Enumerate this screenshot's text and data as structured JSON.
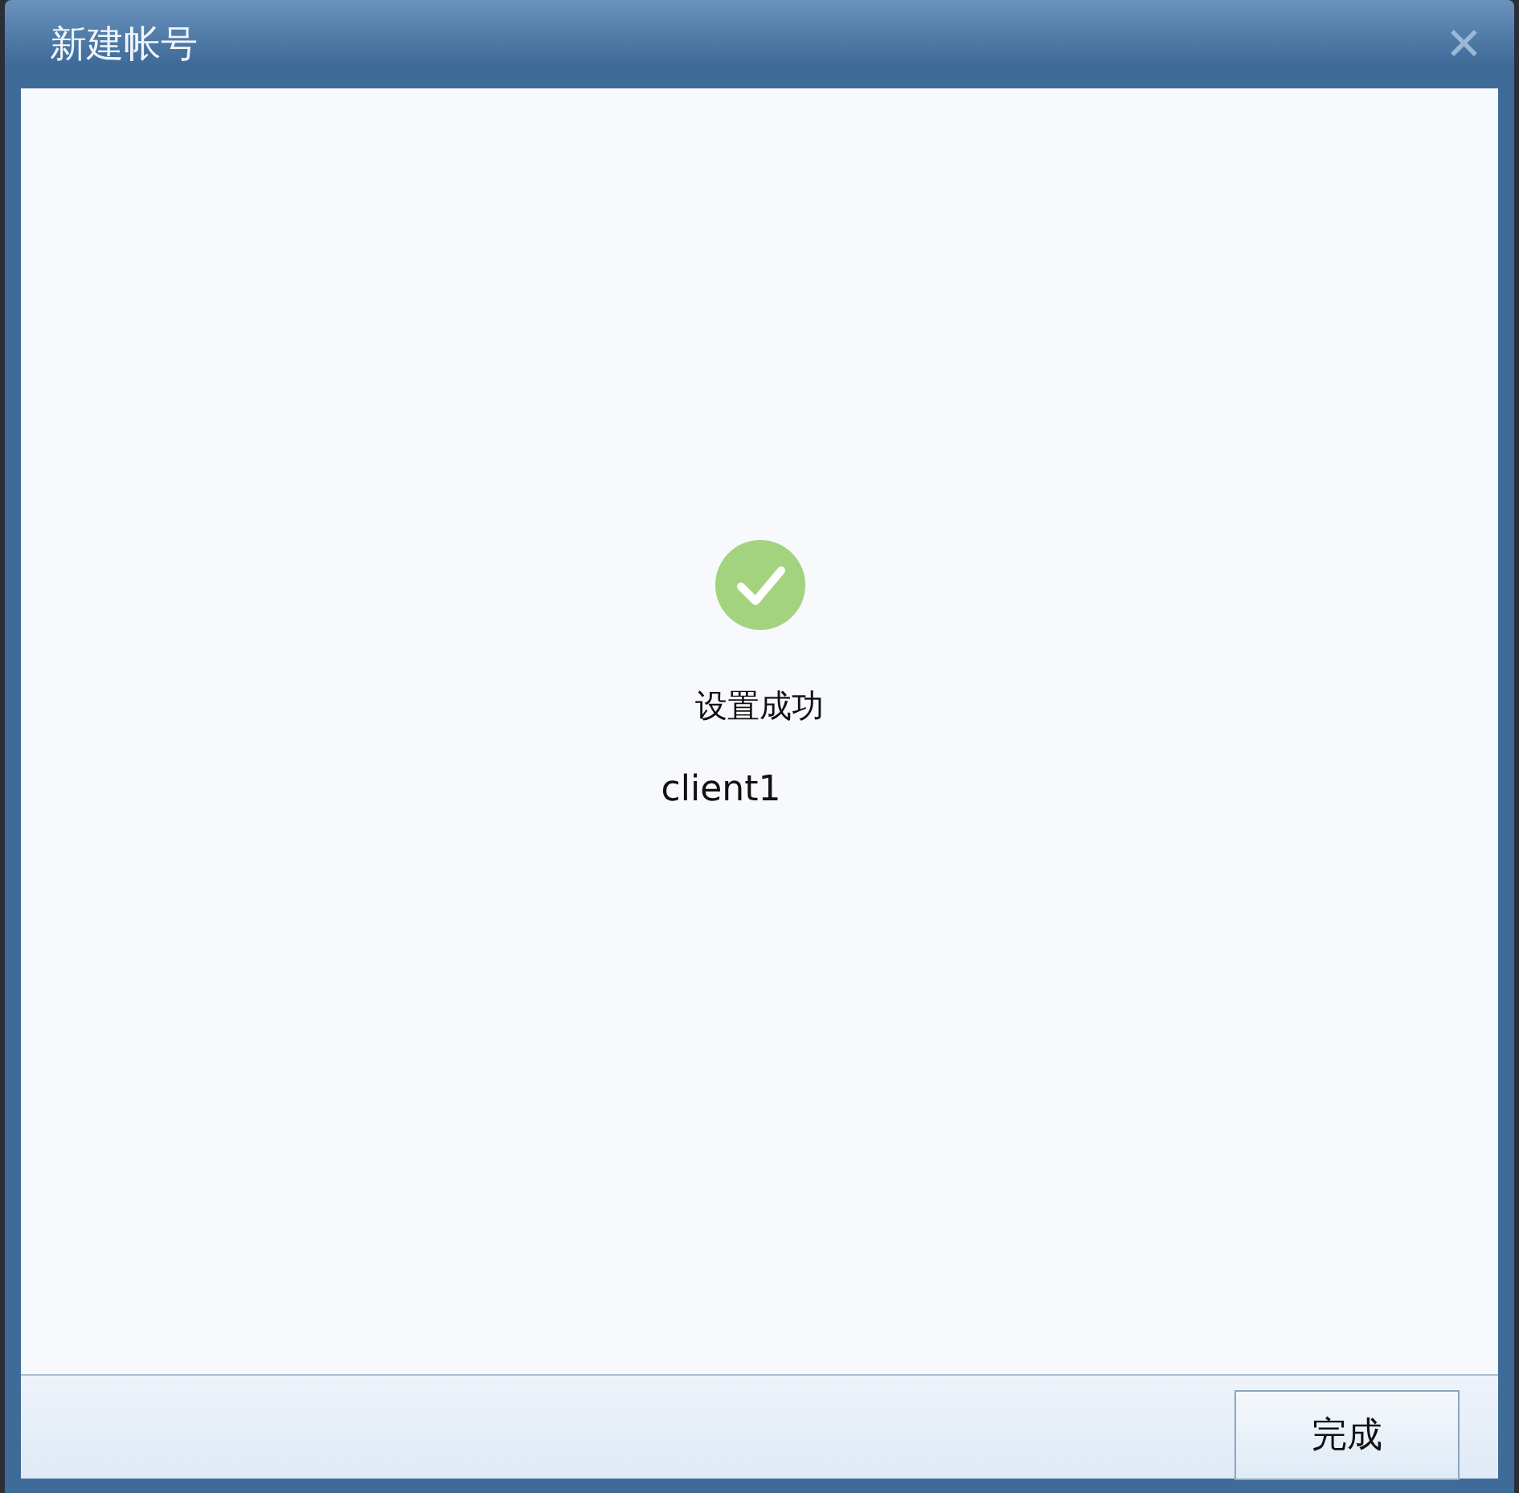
{
  "window": {
    "title": "新建帐号",
    "close": "✕"
  },
  "result": {
    "message": "设置成功",
    "account": "client1"
  },
  "buttons": [
    "完成"
  ]
}
